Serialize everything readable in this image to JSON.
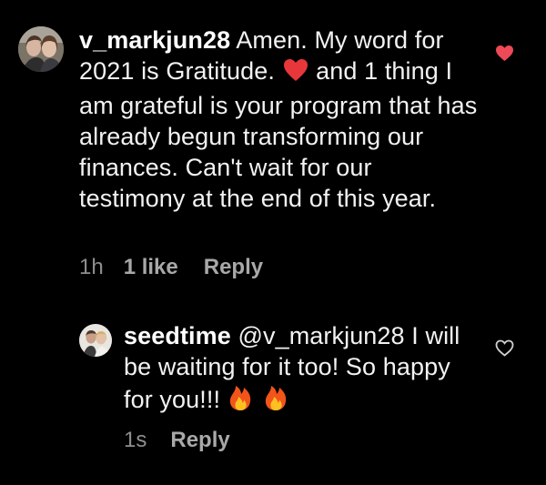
{
  "comments": [
    {
      "username": "v_markjun28",
      "text_before_emoji": "Amen. My word for 2021 is Gratitude.",
      "emoji": "red-heart-emoji",
      "text_after_emoji": "and 1 thing I am grateful is your program that has already begun transforming our finances. Can't wait for our testimony at the end of this year.",
      "time": "1h",
      "likes": "1 like",
      "reply_label": "Reply",
      "liked": true,
      "like_color": "#ed4956"
    },
    {
      "username": "seedtime",
      "mention": "@v_markjun28",
      "text": "I will be waiting for it too!  So happy for you!!!",
      "emojis": [
        "fire-emoji",
        "fire-emoji"
      ],
      "time": "1s",
      "reply_label": "Reply",
      "liked": false
    }
  ]
}
